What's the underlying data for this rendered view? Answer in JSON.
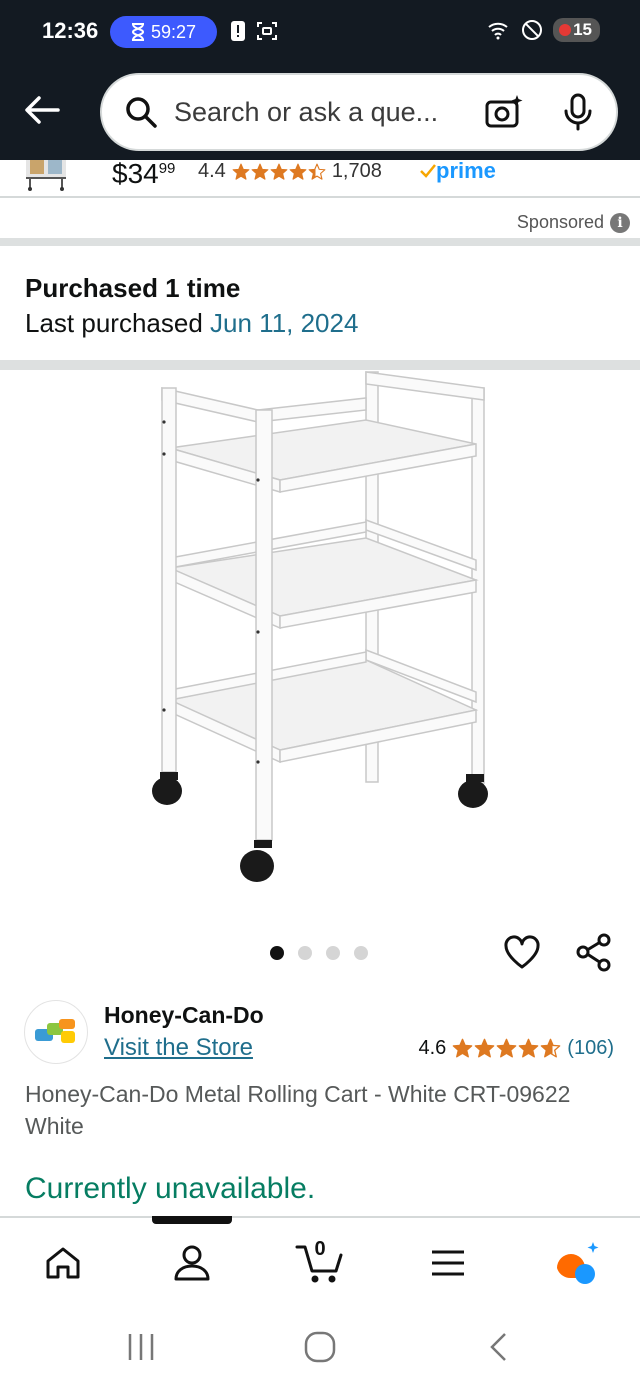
{
  "status": {
    "time": "12:36",
    "timer": "59:27",
    "battery": "15",
    "colors": {
      "bar": "#131a22",
      "timer_pill": "#3d5afe"
    }
  },
  "search": {
    "placeholder": "Search or ask a que..."
  },
  "sponsored_item": {
    "price_dollars": "$34",
    "price_cents": "99",
    "rating": "4.4",
    "rating_stars": 4.4,
    "review_count": "1,708",
    "prime_label": "prime",
    "sponsored_label": "Sponsored",
    "info_icon": "i"
  },
  "purchase_history": {
    "purchased": "Purchased 1 time",
    "last_purchased_label": "Last purchased ",
    "last_purchased_date": "Jun 11, 2024"
  },
  "gallery": {
    "image_count": 4,
    "active_index": 0
  },
  "store": {
    "name": "Honey-Can-Do",
    "visit_label": "Visit the Store",
    "rating": "4.6",
    "rating_stars": 4.6,
    "review_count": "(106)"
  },
  "product": {
    "title": "Honey-Can-Do Metal Rolling Cart - White CRT-09622 White",
    "availability": "Currently unavailable."
  },
  "bottom_nav": {
    "items": [
      "home-icon",
      "account-icon",
      "cart-icon",
      "menu-icon",
      "rufus-icon"
    ],
    "active": "account-icon",
    "cart_count": "0"
  },
  "colors": {
    "link": "#1f6e8c",
    "star": "#de7921",
    "available_green": "#067d62",
    "prime_blue": "#1a98ff"
  }
}
